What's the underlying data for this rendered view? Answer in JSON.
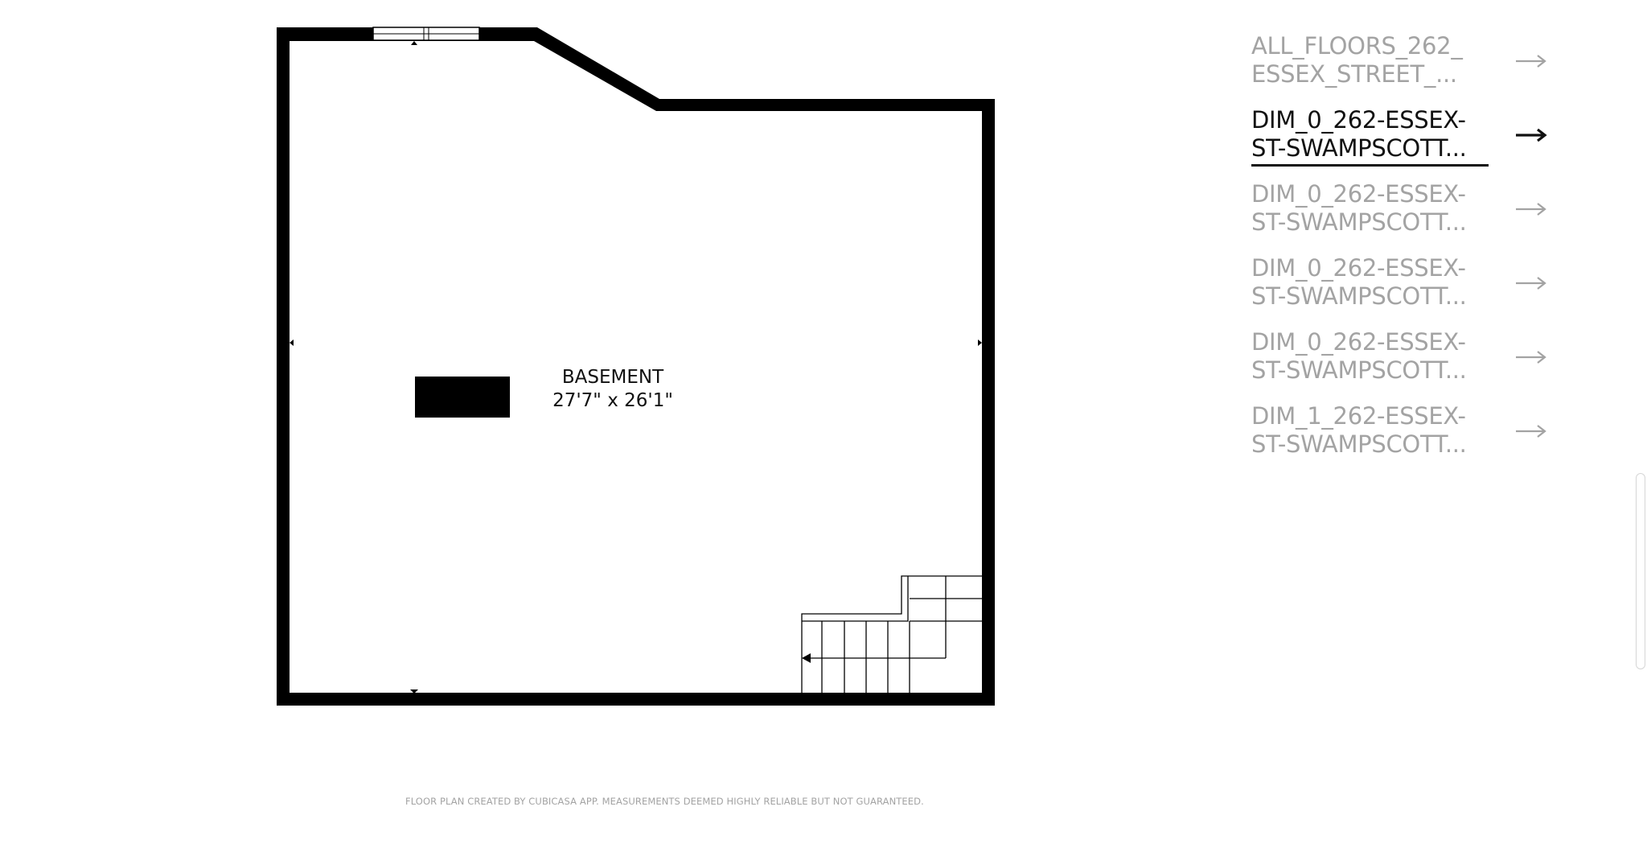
{
  "floor_plan": {
    "room_name": "BASEMENT",
    "room_dimensions": "27'7\" x 26'1\"",
    "disclaimer": "FLOOR PLAN CREATED BY CUBICASA APP. MEASUREMENTS DEEMED HIGHLY RELIABLE BUT NOT GUARANTEED."
  },
  "files": [
    {
      "line1": "ALL_FLOORS_262_",
      "line2": "ESSEX_STREET_...",
      "active": false
    },
    {
      "line1": "DIM_0_262-ESSEX-",
      "line2": "ST-SWAMPSCOTT...",
      "active": true
    },
    {
      "line1": "DIM_0_262-ESSEX-",
      "line2": "ST-SWAMPSCOTT...",
      "active": false
    },
    {
      "line1": "DIM_0_262-ESSEX-",
      "line2": "ST-SWAMPSCOTT...",
      "active": false
    },
    {
      "line1": "DIM_0_262-ESSEX-",
      "line2": "ST-SWAMPSCOTT...",
      "active": false
    },
    {
      "line1": "DIM_1_262-ESSEX-",
      "line2": "ST-SWAMPSCOTT...",
      "active": false
    }
  ],
  "icons": {
    "file_arrow": "arrow-right-icon"
  },
  "colors": {
    "active_text": "#111111",
    "inactive_text": "#a3a3a3",
    "wall": "#000000"
  }
}
